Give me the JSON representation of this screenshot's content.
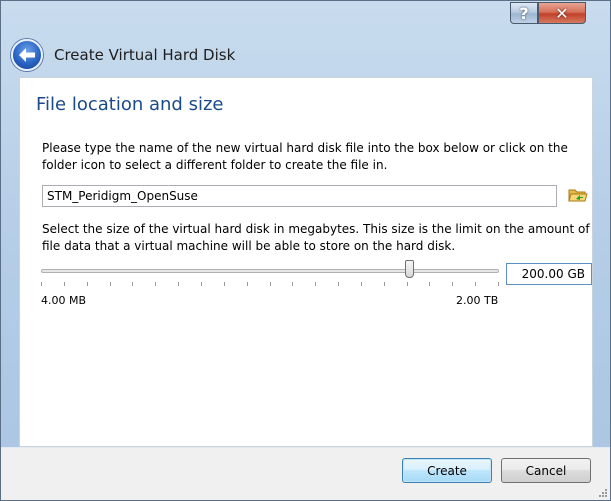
{
  "window": {
    "help_glyph": "?",
    "close_glyph": "✕"
  },
  "header": {
    "title": "Create Virtual Hard Disk"
  },
  "content": {
    "section_title": "File location and size",
    "file_instructions": "Please type the name of the new virtual hard disk file into the box below or click on the folder icon to select a different folder to create the file in.",
    "file_name_value": "STM_Peridigm_OpenSuse",
    "size_instructions": "Select the size of the virtual hard disk in megabytes. This size is the limit on the amount of file data that a virtual machine will be able to store on the hard disk.",
    "size_value": "200.00 GB",
    "slider_min_label": "4.00 MB",
    "slider_max_label": "2.00 TB",
    "slider_position_fraction": 0.81
  },
  "buttons": {
    "create": "Create",
    "cancel": "Cancel"
  },
  "icons": {
    "back": "back-arrow-icon",
    "folder": "folder-open-icon"
  }
}
